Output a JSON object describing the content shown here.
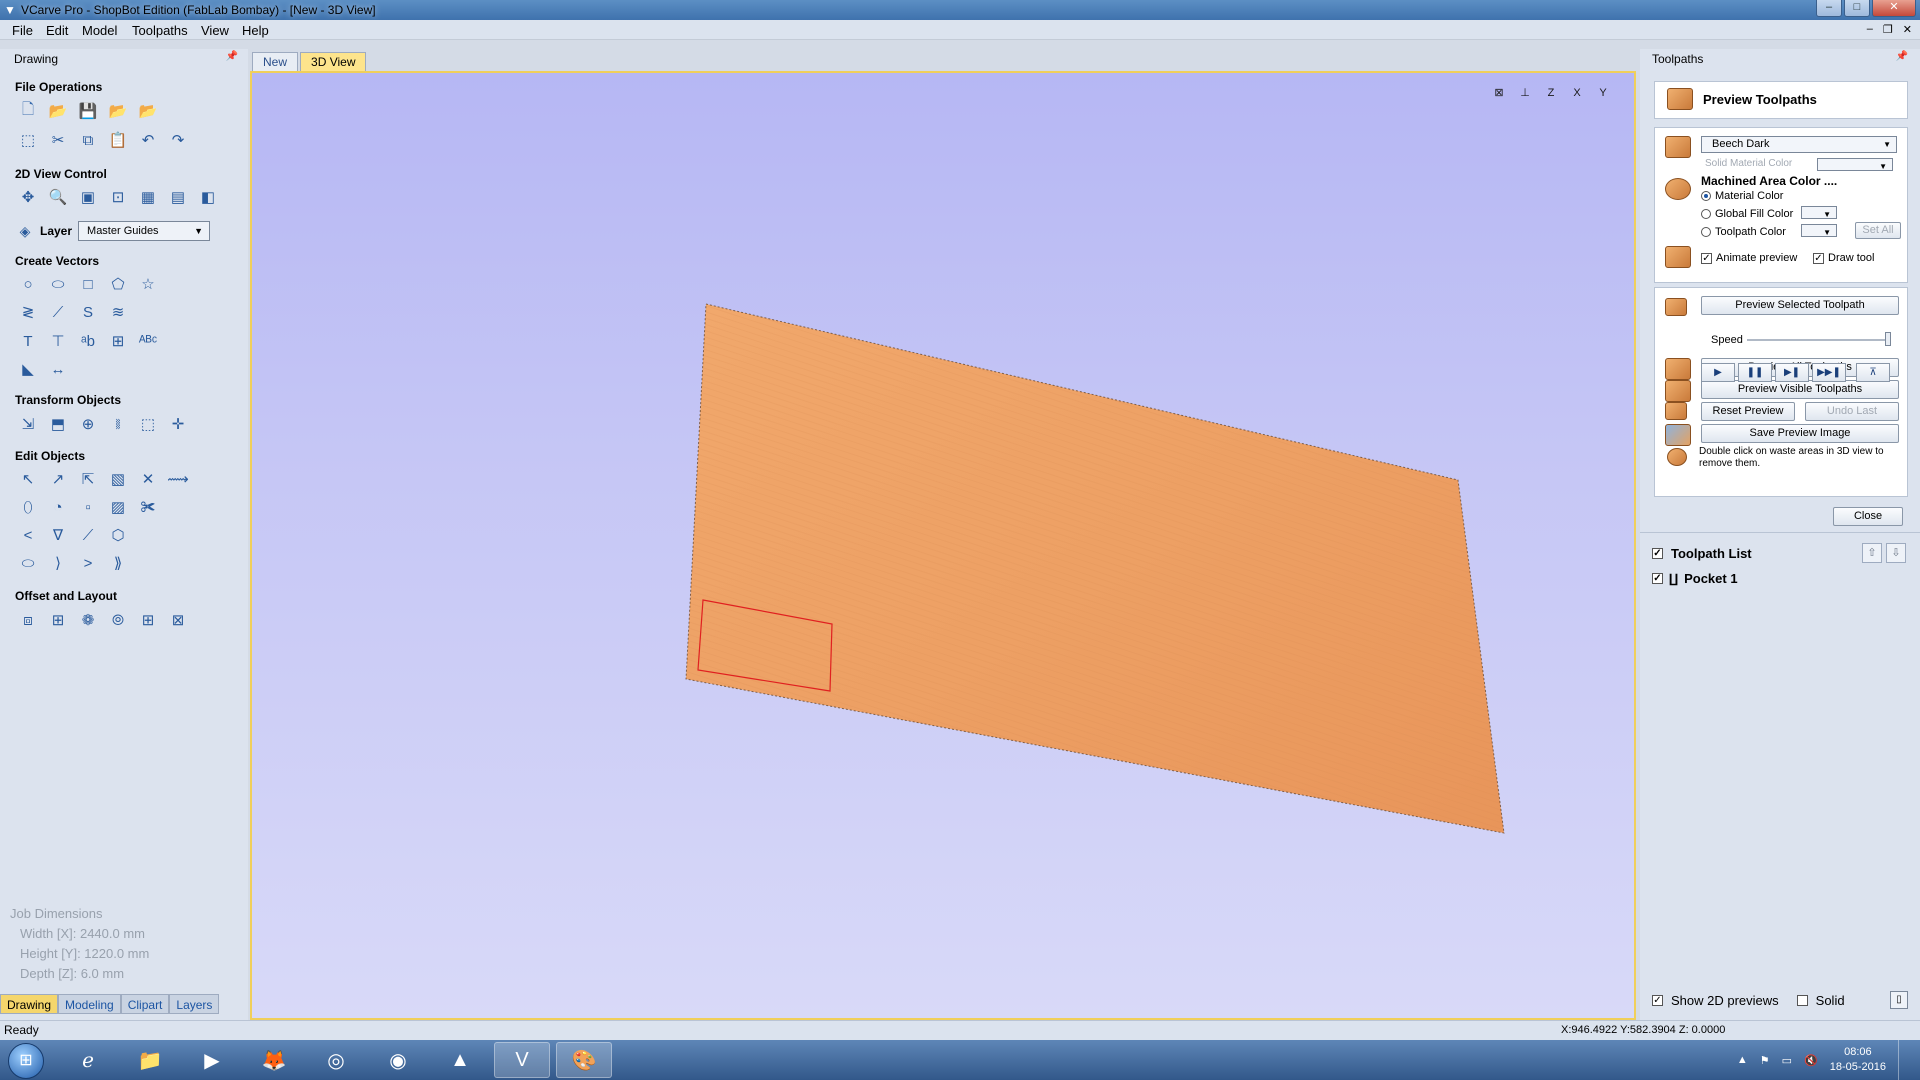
{
  "window": {
    "title": "VCarve Pro - ShopBot Edition (FabLab Bombay) - [New - 3D View]"
  },
  "menu": {
    "items": [
      "File",
      "Edit",
      "Model",
      "Toolpaths",
      "View",
      "Help"
    ]
  },
  "left_panel": {
    "title": "Drawing",
    "sections": {
      "file_ops": "File Operations",
      "view_control": "2D View Control",
      "create_vectors": "Create Vectors",
      "transform": "Transform Objects",
      "edit": "Edit Objects",
      "offset": "Offset and Layout"
    },
    "layer_label": "Layer",
    "layer_value": "Master Guides",
    "job_dimensions": {
      "title": "Job Dimensions",
      "width": "Width  [X]: 2440.0 mm",
      "height": "Height [Y]: 1220.0 mm",
      "depth": "Depth  [Z]: 6.0 mm"
    },
    "tabs": [
      "Drawing",
      "Modeling",
      "Clipart",
      "Layers"
    ]
  },
  "view_tabs": [
    "New",
    "3D View"
  ],
  "right_panel": {
    "title": "Toolpaths",
    "preview_title": "Preview Toolpaths",
    "material": "Beech Dark",
    "solid_material_color": "Solid Material Color",
    "machined_area_color": "Machined Area Color ....",
    "radio_material_color": "Material Color",
    "radio_global_fill": "Global Fill Color",
    "radio_toolpath_color": "Toolpath Color",
    "set_all": "Set All",
    "animate_preview": "Animate preview",
    "draw_tool": "Draw tool",
    "preview_selected": "Preview Selected Toolpath",
    "speed": "Speed",
    "preview_all": "Preview All Toolpaths",
    "preview_visible": "Preview Visible Toolpaths",
    "reset_preview": "Reset Preview",
    "undo_last": "Undo Last",
    "save_image": "Save Preview Image",
    "hint": "Double click on waste areas in 3D view to remove them.",
    "close": "Close",
    "toolpath_list": "Toolpath List",
    "toolpath_items": [
      "Pocket 1"
    ],
    "show_2d_previews": "Show 2D previews",
    "solid": "Solid"
  },
  "status": {
    "ready": "Ready",
    "coords": "X:946.4922 Y:582.3904 Z: 0.0000"
  },
  "taskbar": {
    "time": "08:06",
    "date": "18-05-2016"
  },
  "colors": {
    "viewport_top": "#b6b7f4",
    "wood": "#eea063",
    "toolpath_rect": "#e02020",
    "tab_active": "#fde48c"
  },
  "icons": {
    "view_icons": [
      "fit-view-icon",
      "iso-view-icon",
      "z-view-icon",
      "x-view-icon",
      "y-view-icon"
    ]
  }
}
